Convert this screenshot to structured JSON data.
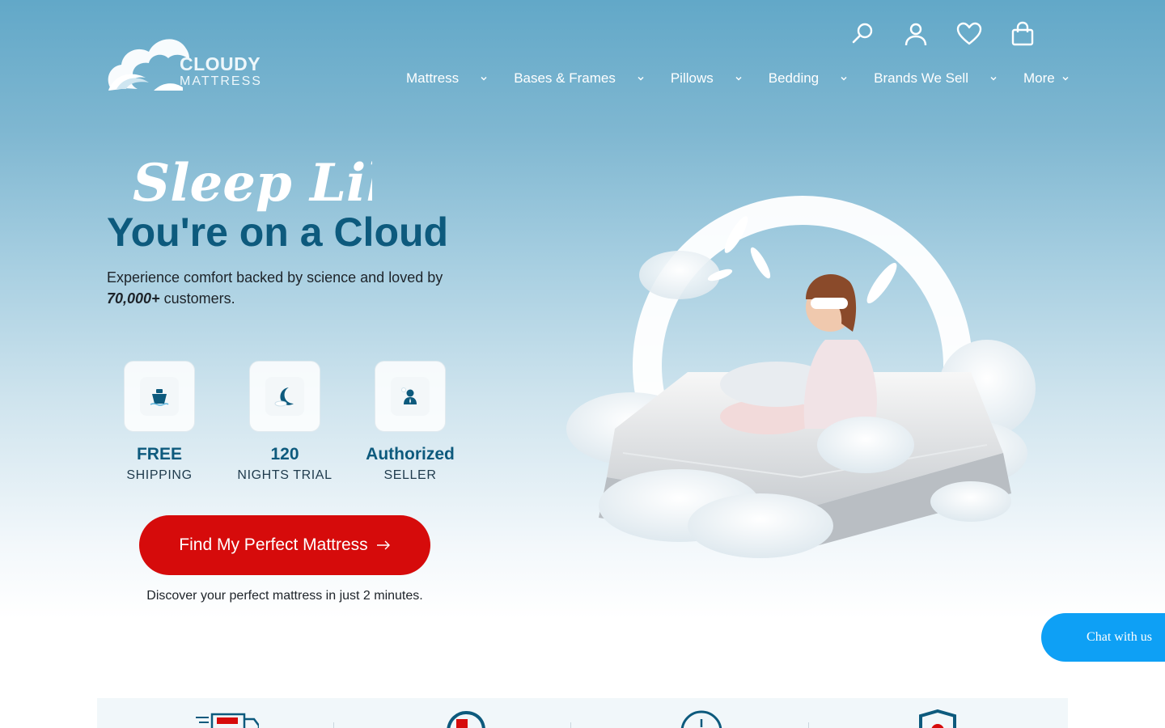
{
  "brand": {
    "name_top": "CLOUDY",
    "name_bottom": "MATTRESS"
  },
  "header_icons": [
    "search-icon",
    "account-icon",
    "wishlist-icon",
    "cart-icon"
  ],
  "nav": {
    "items": [
      {
        "label": "Mattress"
      },
      {
        "label": "Bases & Frames"
      },
      {
        "label": "Pillows"
      },
      {
        "label": "Bedding"
      },
      {
        "label": "Brands We Sell"
      },
      {
        "label": "More"
      }
    ]
  },
  "hero": {
    "script_line": "Sleep Like",
    "title": "You're on a Cloud",
    "subtitle_prefix": "Experience comfort backed by science and loved by",
    "subtitle_highlight": "70,000+",
    "subtitle_suffix": " customers.",
    "features": [
      {
        "big": "FREE",
        "small": "SHIPPING",
        "icon": "shipping-icon"
      },
      {
        "big": "120",
        "small": "NIGHTS TRIAL",
        "icon": "moon-icon"
      },
      {
        "big": "Authorized",
        "small": "SELLER",
        "icon": "seller-icon"
      }
    ],
    "cta_label": "Find My Perfect Mattress",
    "cta_note": "Discover your perfect mattress in just 2 minutes."
  },
  "chat": {
    "label": "Chat with us"
  },
  "colors": {
    "accent": "#0d5a7d",
    "cta": "#d60b0b",
    "chat": "#0ea0f5"
  }
}
